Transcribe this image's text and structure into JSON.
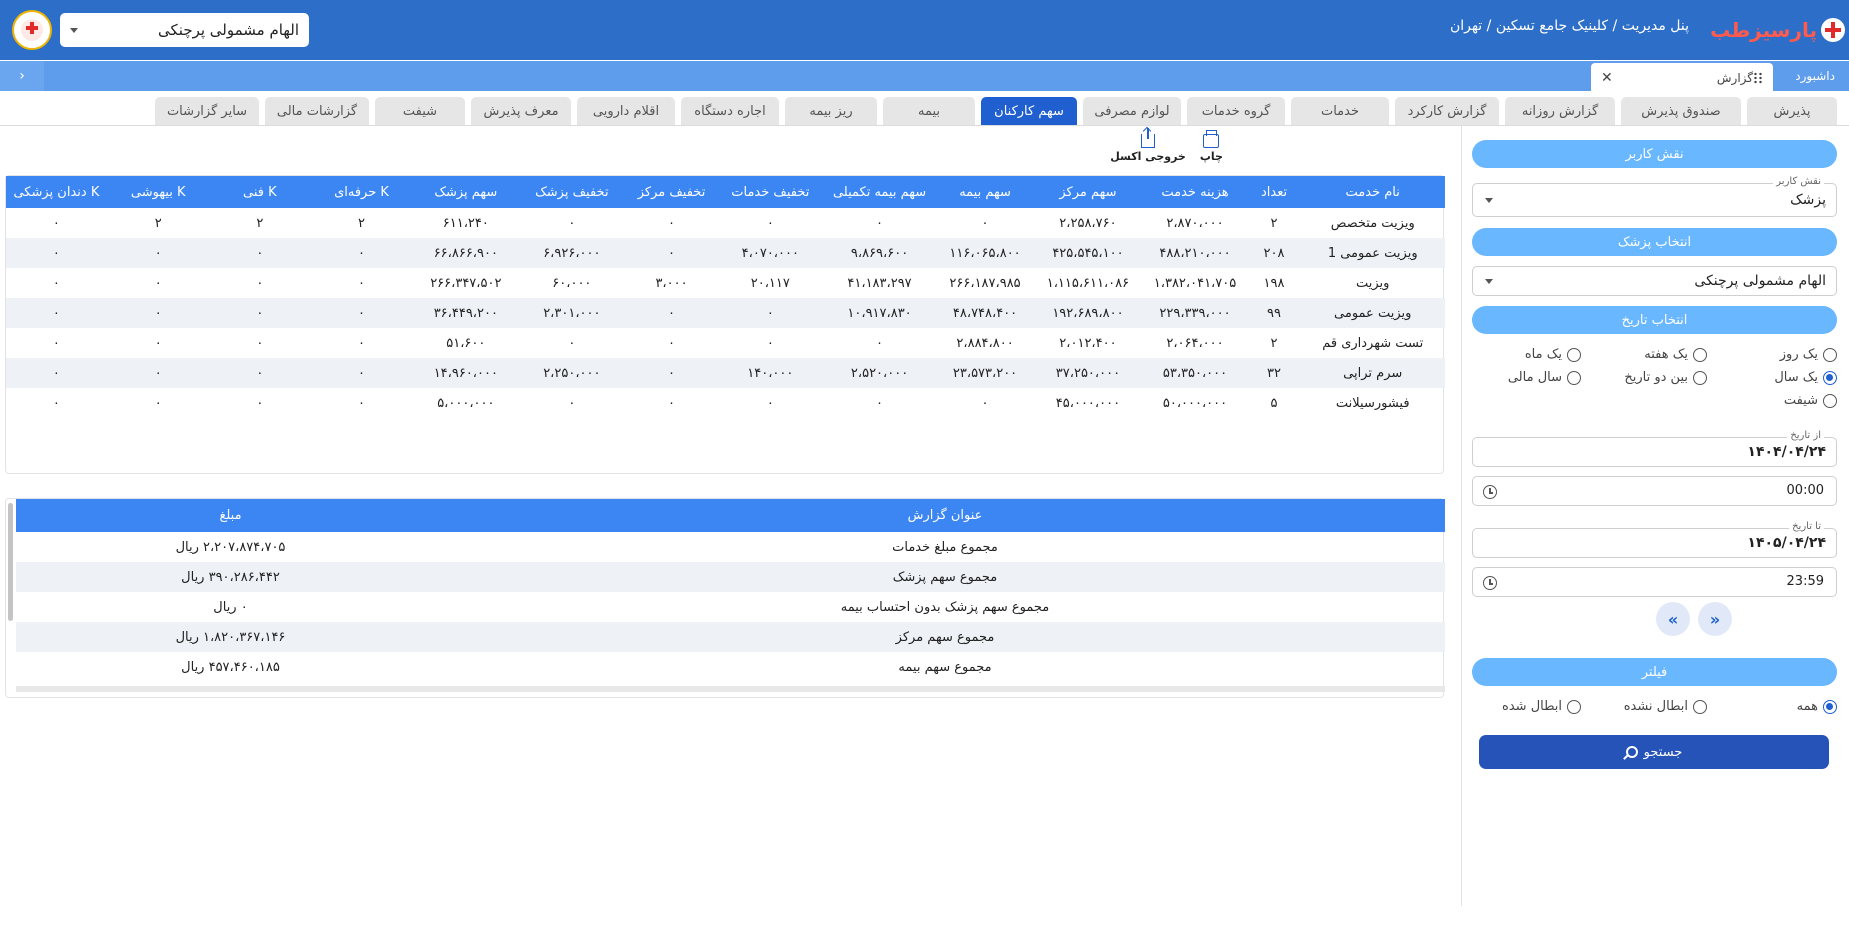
{
  "header": {
    "logo_text": "پارسیزطب",
    "breadcrumb": "پنل مدیریت / کلینیک جامع تسکین / تهران",
    "user_name": "الهام مشمولی پرچنکی"
  },
  "pagebar": {
    "dashboard_label": "داشبورد",
    "report_tab_label": "گزارش",
    "collapse_label": "›"
  },
  "tabs": [
    {
      "label": "پذیرش",
      "w": 90
    },
    {
      "label": "صندوق پذیرش",
      "w": 120
    },
    {
      "label": "گزارش روزانه",
      "w": 110
    },
    {
      "label": "گزارش کارکرد",
      "w": 104
    },
    {
      "label": "خدمات",
      "w": 98
    },
    {
      "label": "گروه خدمات",
      "w": 98
    },
    {
      "label": "لوازم مصرفی",
      "w": 98
    },
    {
      "label": "سهم کارکنان",
      "w": 96
    },
    {
      "label": "بیمه",
      "w": 92
    },
    {
      "label": "ریز بیمه",
      "w": 92
    },
    {
      "label": "اجاره دستگاه",
      "w": 98
    },
    {
      "label": "اقلام دارویی",
      "w": 98
    },
    {
      "label": "معرف پذیرش",
      "w": 100
    },
    {
      "label": "شیفت",
      "w": 90
    },
    {
      "label": "گزارشات مالی",
      "w": 104
    },
    {
      "label": "سایر گزارشات",
      "w": 104
    }
  ],
  "active_tab": "سهم کارکنان",
  "sidebar": {
    "user_role_header": "نقش کاربر",
    "user_role_label": "نقش کاربر",
    "user_role_value": "پزشک",
    "doctor_header": "انتخاب پزشک",
    "doctor_value": "الهام مشمولی پرچنکی",
    "date_header": "انتخاب تاریخ",
    "period_options": [
      "یک روز",
      "یک هفته",
      "یک ماه",
      "یک سال",
      "بین دو تاریخ",
      "سال مالی",
      "شیفت"
    ],
    "period_selected": "یک سال",
    "from_date_label": "از تاریخ",
    "from_date": "۱۴۰۴/۰۴/۲۴",
    "from_time": "00:00",
    "to_date_label": "تا تاریخ",
    "to_date": "۱۴۰۵/۰۴/۲۴",
    "to_time": "23:59",
    "filter_header": "فیلتر",
    "filter_options": [
      "همه",
      "ابطال نشده",
      "ابطال شده"
    ],
    "filter_selected": "همه",
    "search_label": "جستجو"
  },
  "toolbar": {
    "print_label": "چاپ",
    "excel_label": "خروجی اکسل"
  },
  "service_table": {
    "columns": [
      "نام خدمت",
      "تعداد",
      "هزینه خدمت",
      "سهم مرکز",
      "سهم بیمه",
      "سهم بیمه تکمیلی",
      "تخفیف خدمات",
      "تخفیف مرکز",
      "تخفیف پزشک",
      "سهم پزشک",
      "K حرفه‌ای",
      "K فنی",
      "K بیهوشی",
      "K دندان پزشکی"
    ],
    "rows": [
      [
        "ویزیت متخصص",
        "۲",
        "۲،۸۷۰،۰۰۰",
        "۲،۲۵۸،۷۶۰",
        "۰",
        "۰",
        "۰",
        "۰",
        "۰",
        "۶۱۱،۲۴۰",
        "۲",
        "۲",
        "۲",
        "۰"
      ],
      [
        "ویزیت عمومی 1",
        "۲۰۸",
        "۴۸۸،۲۱۰،۰۰۰",
        "۴۲۵،۵۴۵،۱۰۰",
        "۱۱۶،۰۶۵،۸۰۰",
        "۹،۸۶۹،۶۰۰",
        "۴،۰۷۰،۰۰۰",
        "۰",
        "۶،۹۲۶،۰۰۰",
        "۶۶،۸۶۶،۹۰۰",
        "۰",
        "۰",
        "۰",
        "۰"
      ],
      [
        "ویزیت",
        "۱۹۸",
        "۱،۳۸۲،۰۴۱،۷۰۵",
        "۱،۱۱۵،۶۱۱،۰۸۶",
        "۲۶۶،۱۸۷،۹۸۵",
        "۴۱،۱۸۳،۲۹۷",
        "۲۰،۱۱۷",
        "۳،۰۰۰",
        "۶۰،۰۰۰",
        "۲۶۶،۳۴۷،۵۰۲",
        "۰",
        "۰",
        "۰",
        "۰"
      ],
      [
        "ویزیت عمومی",
        "۹۹",
        "۲۲۹،۳۳۹،۰۰۰",
        "۱۹۲،۶۸۹،۸۰۰",
        "۴۸،۷۴۸،۴۰۰",
        "۱۰،۹۱۷،۸۳۰",
        "۰",
        "۰",
        "۲،۳۰۱،۰۰۰",
        "۳۶،۴۴۹،۲۰۰",
        "۰",
        "۰",
        "۰",
        "۰"
      ],
      [
        "تست شهرداری قم",
        "۲",
        "۲،۰۶۴،۰۰۰",
        "۲،۰۱۲،۴۰۰",
        "۲،۸۸۴،۸۰۰",
        "۰",
        "۰",
        "۰",
        "۰",
        "۵۱،۶۰۰",
        "۰",
        "۰",
        "۰",
        "۰"
      ],
      [
        "سرم تراپی",
        "۳۲",
        "۵۳،۳۵۰،۰۰۰",
        "۳۷،۲۵۰،۰۰۰",
        "۲۳،۵۷۳،۲۰۰",
        "۲،۵۲۰،۰۰۰",
        "۱۴۰،۰۰۰",
        "۰",
        "۲،۲۵۰،۰۰۰",
        "۱۴،۹۶۰،۰۰۰",
        "۰",
        "۰",
        "۰",
        "۰"
      ],
      [
        "فیشورسیلانت",
        "۵",
        "۵۰،۰۰۰،۰۰۰",
        "۴۵،۰۰۰،۰۰۰",
        "۰",
        "۰",
        "۰",
        "۰",
        "۰",
        "۵،۰۰۰،۰۰۰",
        "۰",
        "۰",
        "۰",
        "۰"
      ]
    ]
  },
  "summary_table": {
    "columns": [
      "عنوان گزارش",
      "مبلغ"
    ],
    "rows": [
      [
        "مجموع مبلغ خدمات",
        "۲،۲۰۷،۸۷۴،۷۰۵ ریال"
      ],
      [
        "مجموع سهم پزشک",
        "۳۹۰،۲۸۶،۴۴۲ ریال"
      ],
      [
        "مجموع سهم پزشک بدون احتساب بیمه",
        "۰ ریال"
      ],
      [
        "مجموع سهم مرکز",
        "۱،۸۲۰،۳۶۷،۱۴۶ ریال"
      ],
      [
        "مجموع سهم بیمه",
        "۴۵۷،۴۶۰،۱۸۵ ریال"
      ]
    ]
  },
  "colors": {
    "header_bg": "#2d6fc8",
    "pagebar_bg": "#5e9cec",
    "active_tab": "#1f5fd0",
    "section_head": "#68b7ff",
    "table_head": "#3b86f2",
    "search_button": "#2553b8"
  }
}
